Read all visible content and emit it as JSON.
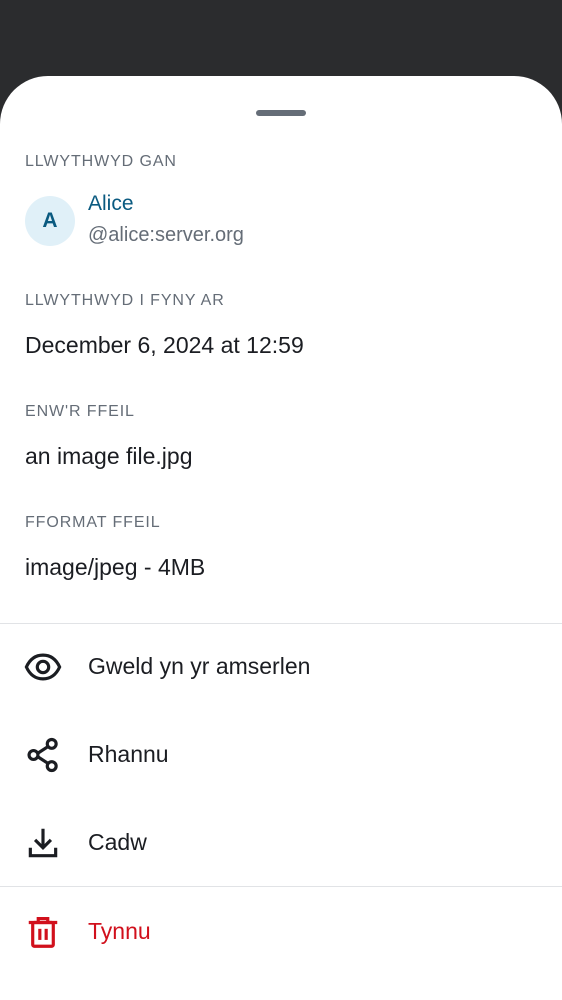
{
  "sender": {
    "section_label": "LLWYTHWYD GAN",
    "avatar_initial": "A",
    "name": "Alice",
    "user_id": "@alice:server.org"
  },
  "uploaded": {
    "section_label": "LLWYTHWYD I FYNY AR",
    "value": "December 6, 2024 at 12:59"
  },
  "filename": {
    "section_label": "ENW'R FFEIL",
    "value": "an image file.jpg"
  },
  "format": {
    "section_label": "FFORMAT FFEIL",
    "value": "image/jpeg - 4MB"
  },
  "actions": [
    {
      "label": "Gweld yn yr amserlen",
      "icon": "eye-icon"
    },
    {
      "label": "Rhannu",
      "icon": "share-icon"
    },
    {
      "label": "Cadw",
      "icon": "download-icon"
    }
  ],
  "danger_action": {
    "label": "Tynnu",
    "icon": "trash-icon"
  },
  "colors": {
    "accent": "#0a5a80",
    "danger": "#d1101c",
    "secondary_text": "#656d77",
    "avatar_bg": "#e0f0f8"
  }
}
